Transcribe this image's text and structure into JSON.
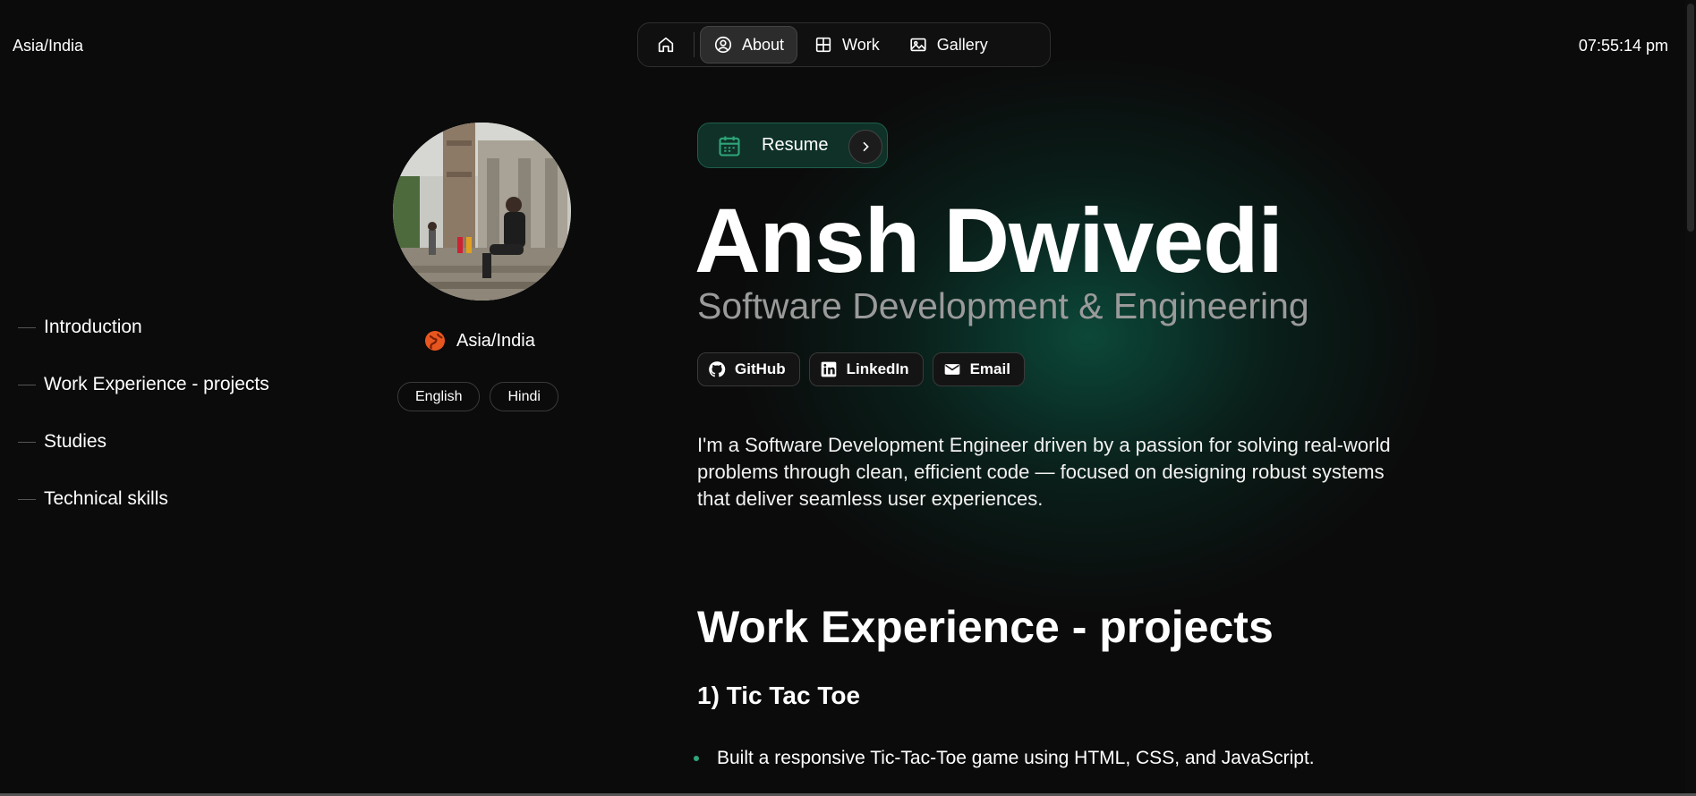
{
  "header": {
    "timezone": "Asia/India",
    "clock": "07:55:14 pm"
  },
  "nav": {
    "items": [
      {
        "label": "",
        "icon": "home-icon"
      },
      {
        "label": "About",
        "icon": "user-circle-icon",
        "active": true
      },
      {
        "label": "Work",
        "icon": "grid-icon"
      },
      {
        "label": "Gallery",
        "icon": "image-icon"
      }
    ]
  },
  "toc": {
    "items": [
      "Introduction",
      "Work Experience - projects",
      "Studies",
      "Technical skills"
    ]
  },
  "profile": {
    "location": "Asia/India",
    "languages": [
      "English",
      "Hindi"
    ]
  },
  "hero": {
    "resume_label": "Resume",
    "name": "Ansh Dwivedi",
    "role": "Software Development & Engineering",
    "socials": [
      {
        "label": "GitHub",
        "icon": "github-icon"
      },
      {
        "label": "LinkedIn",
        "icon": "linkedin-icon"
      },
      {
        "label": "Email",
        "icon": "mail-icon"
      }
    ],
    "bio": "I'm a Software Development Engineer driven by a passion for solving real-world problems through clean, efficient code — focused on designing robust systems that deliver seamless user experiences."
  },
  "work": {
    "title": "Work Experience - projects",
    "project_title": "1) Tic Tac Toe",
    "bullet": "Built a responsive Tic-Tac-Toe game using HTML, CSS, and JavaScript."
  },
  "colors": {
    "accent": "#2fa57a",
    "background": "#0b0b0b",
    "resume_bg": "#0f3128"
  }
}
